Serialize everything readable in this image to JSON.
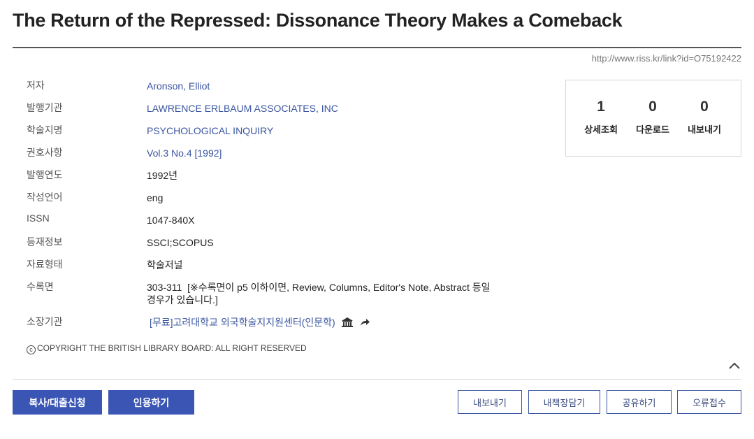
{
  "title": "The Return of the Repressed: Dissonance Theory Makes a Comeback",
  "link_url": "http://www.riss.kr/link?id=O75192422",
  "meta": {
    "author": {
      "key": "저자",
      "value": "Aronson, Elliot"
    },
    "publisher": {
      "key": "발행기관",
      "value": "LAWRENCE ERLBAUM ASSOCIATES, INC"
    },
    "journal": {
      "key": "학술지명",
      "value": "PSYCHOLOGICAL INQUIRY"
    },
    "volume": {
      "key": "권호사항",
      "value": "Vol.3 No.4 [1992]"
    },
    "year": {
      "key": "발행연도",
      "value": "1992년"
    },
    "language": {
      "key": "작성언어",
      "value": "eng"
    },
    "issn": {
      "key": "ISSN",
      "value": "1047-840X"
    },
    "indexing": {
      "key": "등재정보",
      "value": "SSCI;SCOPUS"
    },
    "type": {
      "key": "자료형태",
      "value": "학술저널"
    },
    "pages": {
      "key": "수록면",
      "value": "303-311",
      "note": "[※수록면이 p5 이하이면, Review, Columns, Editor's Note, Abstract 등일 경우가 있습니다.]"
    },
    "holding": {
      "key": "소장기관",
      "value": "[무료]고려대학교 외국학술지지원센터(인문학)"
    }
  },
  "copyright": "COPYRIGHT THE BRITISH LIBRARY BOARD: ALL RIGHT RESERVED",
  "copyright_symbol": "c",
  "stats": [
    {
      "value": "1",
      "label": "상세조회"
    },
    {
      "value": "0",
      "label": "다운로드"
    },
    {
      "value": "0",
      "label": "내보내기"
    }
  ],
  "buttons": {
    "copy_loan": "복사/대출신청",
    "cite": "인용하기",
    "export": "내보내기",
    "bookshelf": "내책장담기",
    "share": "공유하기",
    "report_error": "오류접수"
  },
  "icons": [
    "library-icon",
    "share-arrow-icon",
    "chevron-up-icon"
  ],
  "colors": {
    "link": "#3a55a0",
    "primary_button": "#3a55b4"
  }
}
